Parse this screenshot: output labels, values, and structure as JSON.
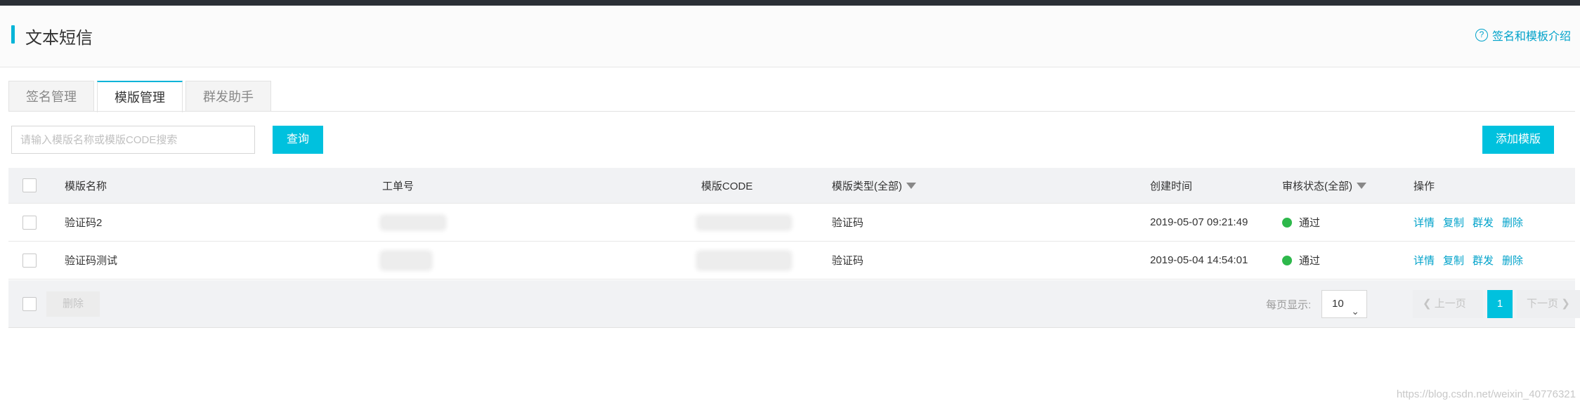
{
  "header": {
    "title": "文本短信",
    "help_link": "签名和模板介绍",
    "help_icon": "question-circle-icon"
  },
  "tabs": [
    {
      "label": "签名管理",
      "active": false
    },
    {
      "label": "模版管理",
      "active": true
    },
    {
      "label": "群发助手",
      "active": false
    }
  ],
  "toolbar": {
    "search_placeholder": "请输入模版名称或模版CODE搜索",
    "search_value": "",
    "query_label": "查询",
    "add_label": "添加模版"
  },
  "table": {
    "columns": {
      "name": "模版名称",
      "ticket": "工单号",
      "code": "模版CODE",
      "type": "模版类型(全部)",
      "created": "创建时间",
      "status": "审核状态(全部)",
      "ops": "操作"
    },
    "rows": [
      {
        "name": "验证码2",
        "type": "验证码",
        "created": "2019-05-07 09:21:49",
        "status": "通过",
        "ops": [
          "详情",
          "复制",
          "群发",
          "删除"
        ]
      },
      {
        "name": "验证码测试",
        "type": "验证码",
        "created": "2019-05-04 14:54:01",
        "status": "通过",
        "ops": [
          "详情",
          "复制",
          "群发",
          "删除"
        ]
      }
    ],
    "status_color": "#2db84b"
  },
  "footer": {
    "delete_label": "删除",
    "page_size_label": "每页显示:",
    "page_size": "10",
    "prev_label": "上一页",
    "current_page": "1",
    "next_label": "下一页"
  },
  "watermark": "https://blog.csdn.net/weixin_40776321",
  "colors": {
    "accent": "#00c1de",
    "link": "#00a2ca"
  }
}
